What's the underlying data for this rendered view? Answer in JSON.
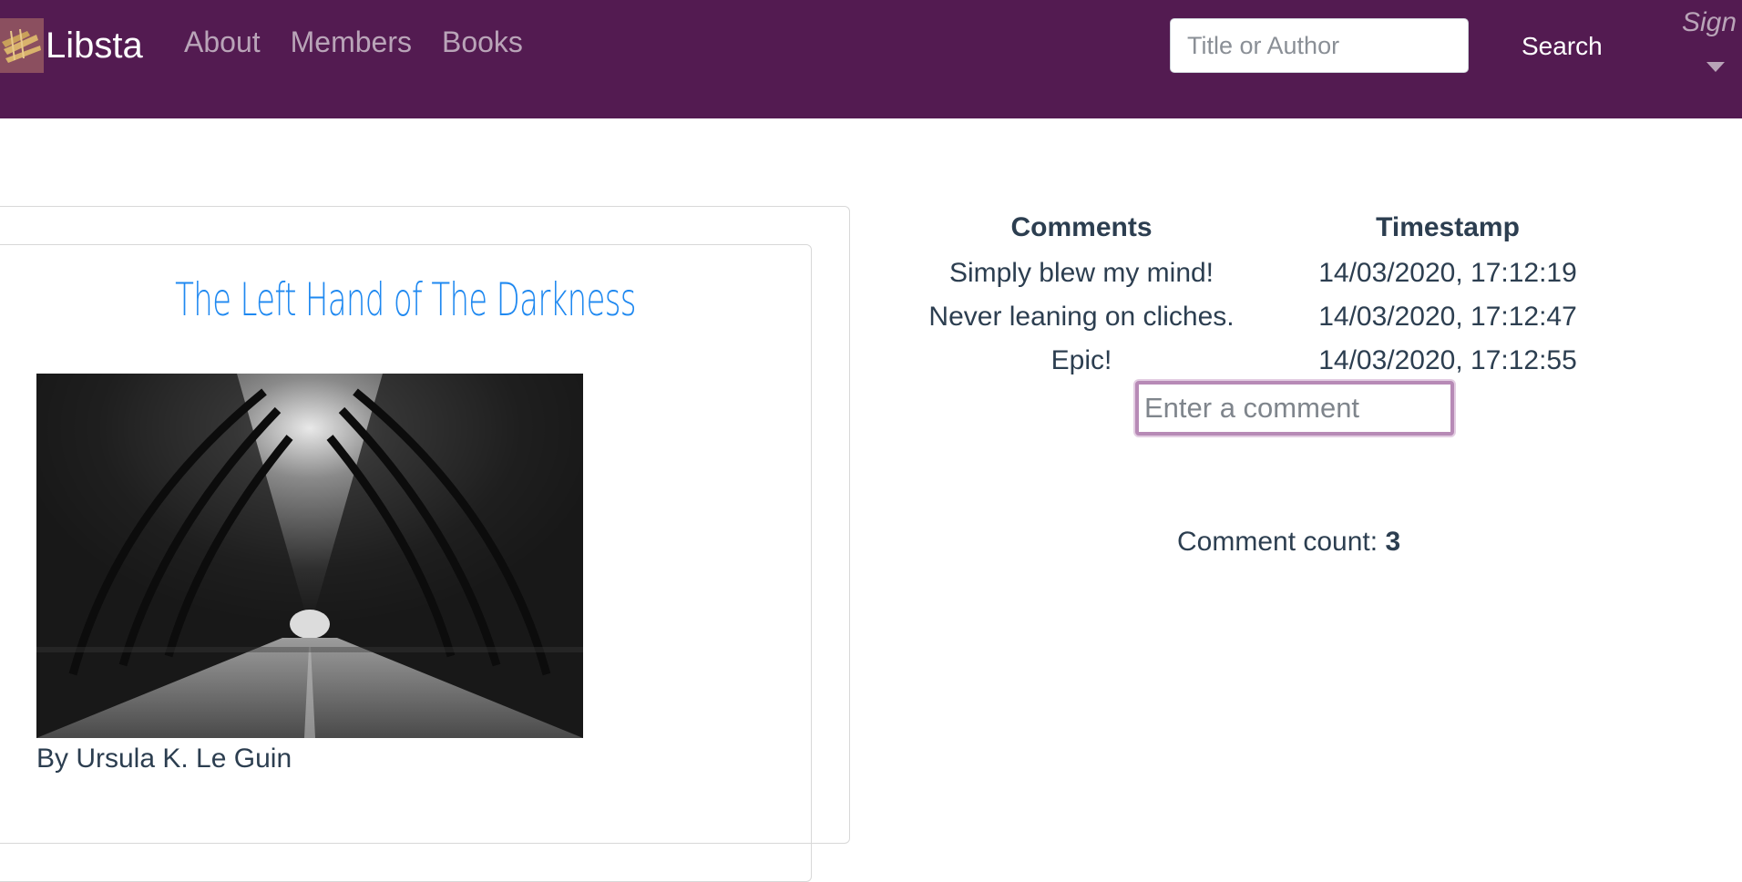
{
  "navbar": {
    "brand": "Libsta",
    "links": [
      "About",
      "Members",
      "Books"
    ],
    "search_placeholder": "Title or Author",
    "search_label": "Search",
    "sign_label": "Sign",
    "background_color": "#531b51"
  },
  "book": {
    "title": "The Left Hand of The Darkness",
    "author": "By Ursula K. Le Guin",
    "title_color": "#1e88f0"
  },
  "comments": {
    "headers": [
      "Comments",
      "Timestamp"
    ],
    "rows": [
      {
        "comment": "Simply blew my mind!",
        "timestamp": "14/03/2020, 17:12:19"
      },
      {
        "comment": "Never leaning on cliches.",
        "timestamp": "14/03/2020, 17:12:47"
      },
      {
        "comment": "Epic!",
        "timestamp": "14/03/2020, 17:12:55"
      }
    ],
    "input_placeholder": "Enter a comment",
    "count_label": "Comment count:",
    "count_value": "3"
  }
}
